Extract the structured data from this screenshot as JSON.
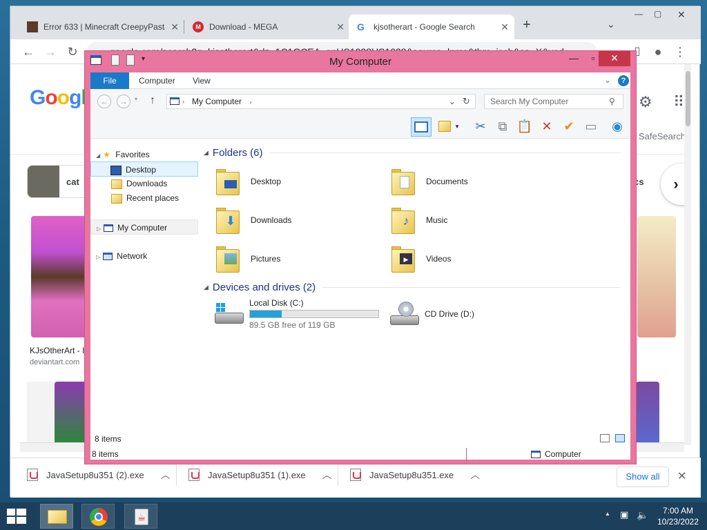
{
  "browser": {
    "tabs": [
      {
        "title": "Error 633 | Minecraft CreepyPasta",
        "active": false
      },
      {
        "title": "Download - MEGA",
        "active": false
      },
      {
        "title": "kjsotherart - Google Search",
        "active": true
      }
    ],
    "new_tab_icon": "plus-icon",
    "url": "google.com/search?q=kjsotherart&rlz=1C1GCEA_enUS1028US1028&source=lnms&tbm=isch&sa=X&ved",
    "google": {
      "logo": "Google",
      "chip_cat": "cat",
      "chip_right": "omics",
      "safesearch": "SafeSearch",
      "result1_title": "KJsOtherArt - I",
      "result1_site": "deviantart.com"
    },
    "downloads": [
      {
        "name": "JavaSetup8u351 (2).exe"
      },
      {
        "name": "JavaSetup8u351 (1).exe"
      },
      {
        "name": "JavaSetup8u351.exe"
      }
    ],
    "show_all": "Show all"
  },
  "explorer": {
    "title": "My Computer",
    "ribbon_tabs": {
      "file": "File",
      "computer": "Computer",
      "view": "View"
    },
    "path": "My Computer",
    "search_placeholder": "Search My Computer",
    "nav": {
      "favorites": "Favorites",
      "desktop": "Desktop",
      "downloads": "Downloads",
      "recent": "Recent places",
      "my_computer": "My Computer",
      "network": "Network"
    },
    "folders_header": "Folders (6)",
    "folders": [
      {
        "name": "Desktop"
      },
      {
        "name": "Documents"
      },
      {
        "name": "Downloads"
      },
      {
        "name": "Music"
      },
      {
        "name": "Pictures"
      },
      {
        "name": "Videos"
      }
    ],
    "devices_header": "Devices and drives (2)",
    "drives": {
      "c_name": "Local Disk (C:)",
      "c_free": "89.5 GB free of 119 GB",
      "c_used_fraction": 0.248,
      "d_name": "CD Drive (D:)"
    },
    "status_items": "8 items",
    "status_bottom_items": "8 items",
    "status_location": "Computer"
  },
  "taskbar": {
    "time": "7:00 AM",
    "date": "10/23/2022"
  },
  "colors": {
    "explorer_frame": "#e9769e",
    "ribbon_file": "#1979ca",
    "close_button": "#c7354a"
  }
}
